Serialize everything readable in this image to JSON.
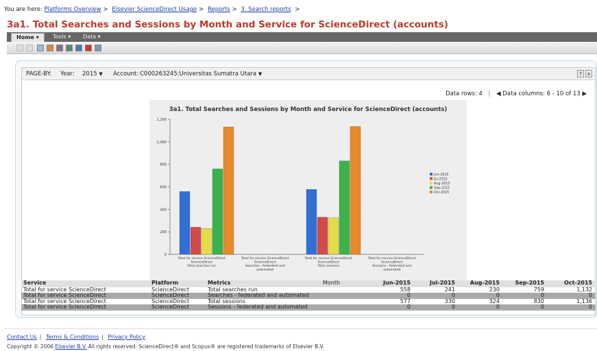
{
  "breadcrumb": {
    "prefix": "You are here:",
    "items": [
      "Platforms Overview",
      "Elsevier ScienceDirect Usage",
      "Reports",
      "3. Search reports"
    ],
    "trailing": ">"
  },
  "page_title": "3a1. Total Searches and Sessions by Month and Service for ScienceDirect (accounts)",
  "menu": {
    "home": "Home ▾",
    "tools": "Tools ▾",
    "data": "Data ▾"
  },
  "toolbar_icons": [
    "undo-icon",
    "redo-icon",
    "grid-icon",
    "chart-icon",
    "grid-chart-icon",
    "export-icon",
    "pdf-icon",
    "print-icon",
    "refresh-icon"
  ],
  "pageby": {
    "label": "PAGE-BY:",
    "year_label": "Year:",
    "year_value": "2015",
    "account_label": "Account:",
    "account_value": "C000263245:Universitas Sumatra Utara",
    "help": "?",
    "close": "x"
  },
  "datarows": {
    "rows": "Data rows: 4",
    "sep": "|",
    "columns": "Data columns: 6 - 10 of 13"
  },
  "chart_data": {
    "type": "bar",
    "title": "3a1. Total Searches and Sessions by Month and Service for ScienceDirect (accounts)",
    "categories": [
      [
        "Total for service ScienceDirect",
        "ScienceDirect",
        "Total searches run"
      ],
      [
        "Total for service ScienceDirect",
        "ScienceDirect",
        "Searches - federated and",
        "automated"
      ],
      [
        "Total for service ScienceDirect",
        "ScienceDirect",
        "Total sessions"
      ],
      [
        "Total for service ScienceDirect",
        "ScienceDirect",
        "Sessions - federated and",
        "automated"
      ]
    ],
    "series": [
      {
        "name": "Jun-2015",
        "color": "#2f6fd6",
        "values": [
          558,
          0,
          577,
          0
        ]
      },
      {
        "name": "Jul-2015",
        "color": "#d24a4a",
        "values": [
          241,
          0,
          330,
          0
        ]
      },
      {
        "name": "Aug-2015",
        "color": "#e5dc4a",
        "values": [
          230,
          0,
          324,
          0
        ]
      },
      {
        "name": "Sep-2015",
        "color": "#3cb34a",
        "values": [
          759,
          0,
          830,
          0
        ]
      },
      {
        "name": "Oct-2015",
        "color": "#e8892a",
        "values": [
          1132,
          0,
          1136,
          0
        ]
      }
    ],
    "ylim": [
      0,
      1200
    ],
    "yticks": [
      "0",
      "200",
      "400",
      "600",
      "800",
      "1,000",
      "1,200"
    ],
    "legend": "right"
  },
  "table": {
    "headers": [
      "Service",
      "Platform",
      "Metrics",
      "Month",
      "Jun-2015",
      "Jul-2015",
      "Aug-2015",
      "Sep-2015",
      "Oct-2015"
    ],
    "rows": [
      {
        "service": "Total for service ScienceDirect",
        "platform": "ScienceDirect",
        "metric": "Total searches run",
        "values": [
          "558",
          "241",
          "230",
          "759",
          "1,132"
        ]
      },
      {
        "service": "Total for service ScienceDirect",
        "platform": "ScienceDirect",
        "metric": "Searches - federated and automated",
        "values": [
          "0",
          "0",
          "0",
          "0",
          "0"
        ]
      },
      {
        "service": "Total for service ScienceDirect",
        "platform": "ScienceDirect",
        "metric": "Total sessions",
        "values": [
          "577",
          "330",
          "324",
          "830",
          "1,136"
        ]
      },
      {
        "service": "Total for service ScienceDirect",
        "platform": "ScienceDirect",
        "metric": "Sessions - federated and automated",
        "values": [
          "0",
          "0",
          "0",
          "0",
          "0"
        ]
      }
    ]
  },
  "footer": {
    "links": [
      "Contact Us",
      "Terms & Conditions",
      "Privacy Policy"
    ],
    "copyright_pre": "Copyright © 2006 ",
    "copyright_link": "Elsevier B.V.",
    "copyright_post": " All rights reserved. ScienceDirect® and Scopus® are registered trademarks of Elsevier B.V."
  }
}
